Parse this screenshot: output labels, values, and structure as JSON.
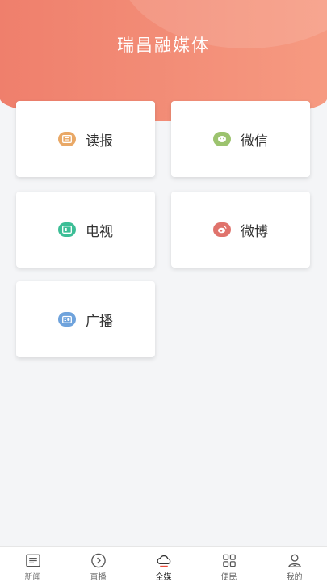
{
  "app": {
    "title": "瑞昌融媒体"
  },
  "cards": [
    {
      "label": "读报",
      "icon": "newspaper-icon",
      "color": "#e9a866"
    },
    {
      "label": "微信",
      "icon": "wechat-icon",
      "color": "#9cc36e"
    },
    {
      "label": "电视",
      "icon": "tv-icon",
      "color": "#3cbe96"
    },
    {
      "label": "微博",
      "icon": "weibo-icon",
      "color": "#e0736c"
    },
    {
      "label": "广播",
      "icon": "radio-icon",
      "color": "#6fa3dc"
    }
  ],
  "tabs": [
    {
      "label": "新闻",
      "icon": "news-icon",
      "active": false
    },
    {
      "label": "直播",
      "icon": "live-play-icon",
      "active": false
    },
    {
      "label": "全媒",
      "icon": "cloud-icon",
      "active": true
    },
    {
      "label": "便民",
      "icon": "grid-apps-icon",
      "active": false
    },
    {
      "label": "我的",
      "icon": "user-icon",
      "active": false
    }
  ],
  "colors": {
    "header_start": "#ef7f6c",
    "header_end": "#f69a81",
    "active_tab": "#e94b3c"
  }
}
